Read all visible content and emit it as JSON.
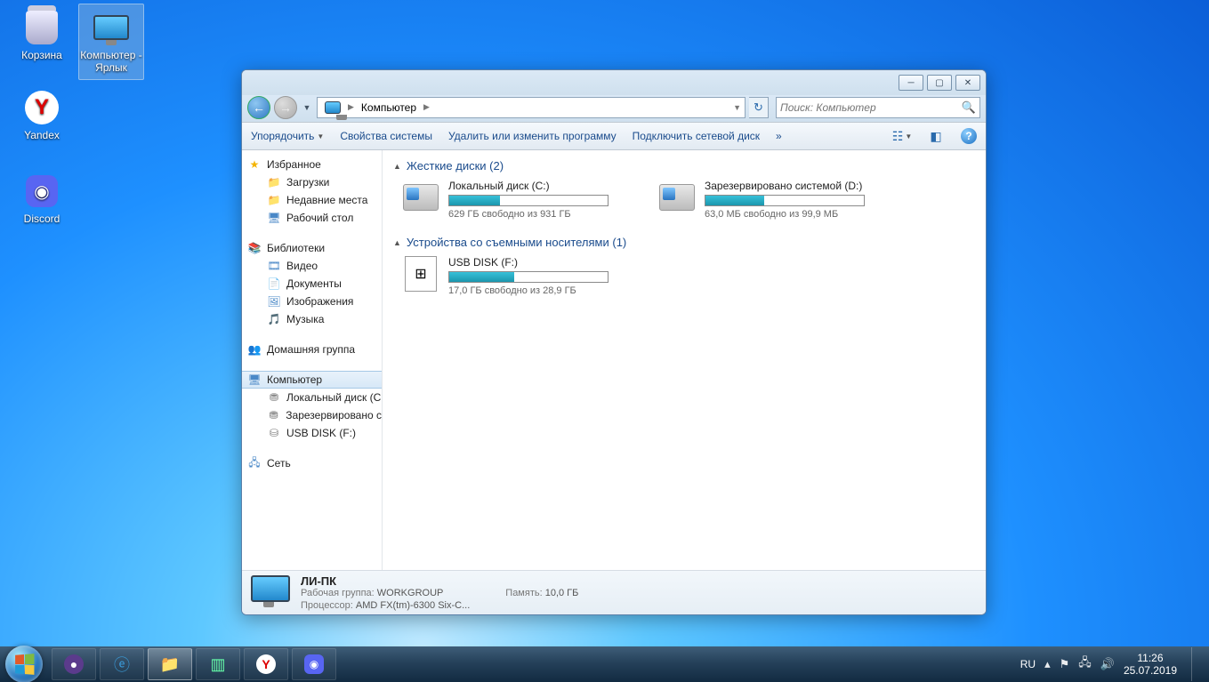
{
  "desktop": {
    "icons": [
      {
        "name": "Корзина"
      },
      {
        "name": "Компьютер - Ярлык",
        "selected": true
      },
      {
        "name": "Yandex"
      },
      {
        "name": "Discord"
      }
    ]
  },
  "window": {
    "breadcrumb": {
      "root": "Компьютер"
    },
    "search_placeholder": "Поиск: Компьютер",
    "toolbar": {
      "organize": "Упорядочить",
      "props": "Свойства системы",
      "uninstall": "Удалить или изменить программу",
      "mapdrive": "Подключить сетевой диск",
      "more": "»"
    },
    "nav": {
      "favorites": "Избранное",
      "downloads": "Загрузки",
      "recent": "Недавние места",
      "desktop": "Рабочий стол",
      "libraries": "Библиотеки",
      "videos": "Видео",
      "documents": "Документы",
      "pictures": "Изображения",
      "music": "Музыка",
      "homegroup": "Домашняя группа",
      "computer": "Компьютер",
      "local_c": "Локальный диск (C:)",
      "reserved_d": "Зарезервировано системой (D:)",
      "reserved_d_short": "Зарезервировано с",
      "local_c_short": "Локальный диск (C",
      "usb": "USB DISK (F:)",
      "network": "Сеть"
    },
    "content": {
      "cat_hdd": "Жесткие диски (2)",
      "cat_rem": "Устройства со съемными носителями (1)",
      "drives": {
        "c": {
          "name": "Локальный диск (C:)",
          "free": "629 ГБ свободно из 931 ГБ",
          "pct": 32
        },
        "d": {
          "name": "Зарезервировано системой (D:)",
          "free": "63,0 МБ свободно из 99,9 МБ",
          "pct": 37
        },
        "f": {
          "name": "USB DISK (F:)",
          "free": "17,0 ГБ свободно из 28,9 ГБ",
          "pct": 41
        }
      }
    },
    "details": {
      "name": "ЛИ-ПК",
      "workgroup_k": "Рабочая группа:",
      "workgroup_v": "WORKGROUP",
      "cpu_k": "Процессор:",
      "cpu_v": "AMD FX(tm)-6300 Six-C...",
      "mem_k": "Память:",
      "mem_v": "10,0 ГБ"
    }
  },
  "taskbar": {
    "lang": "RU",
    "time": "11:26",
    "date": "25.07.2019"
  }
}
